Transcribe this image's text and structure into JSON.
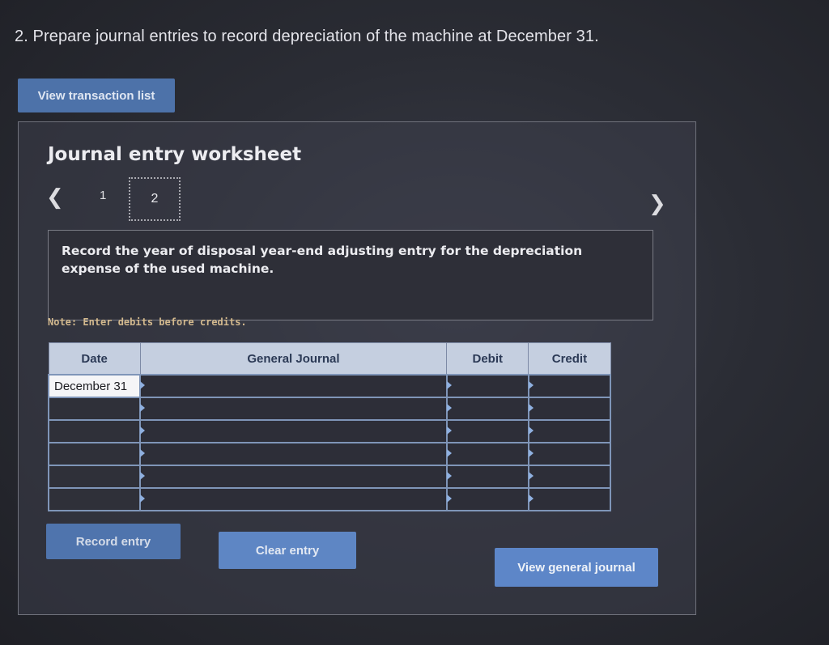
{
  "question": "2. Prepare journal entries to record depreciation of the machine at December 31.",
  "buttons": {
    "view_transactions": "View transaction list",
    "record_entry": "Record entry",
    "clear_entry": "Clear entry",
    "view_general_journal": "View general journal"
  },
  "worksheet": {
    "title": "Journal entry worksheet",
    "tabs": [
      "1",
      "2"
    ],
    "active_tab": "2",
    "instruction": "Record the year of disposal year-end adjusting entry for the depreciation expense of the used machine.",
    "note": "Note: Enter debits before credits."
  },
  "journal": {
    "headers": {
      "date": "Date",
      "general_journal": "General Journal",
      "debit": "Debit",
      "credit": "Credit"
    },
    "rows": [
      {
        "date": "December 31",
        "account": "",
        "debit": "",
        "credit": ""
      },
      {
        "date": "",
        "account": "",
        "debit": "",
        "credit": ""
      },
      {
        "date": "",
        "account": "",
        "debit": "",
        "credit": ""
      },
      {
        "date": "",
        "account": "",
        "debit": "",
        "credit": ""
      },
      {
        "date": "",
        "account": "",
        "debit": "",
        "credit": ""
      },
      {
        "date": "",
        "account": "",
        "debit": "",
        "credit": ""
      }
    ]
  },
  "icons": {
    "prev": "chevron-left-icon",
    "next": "chevron-right-icon"
  }
}
